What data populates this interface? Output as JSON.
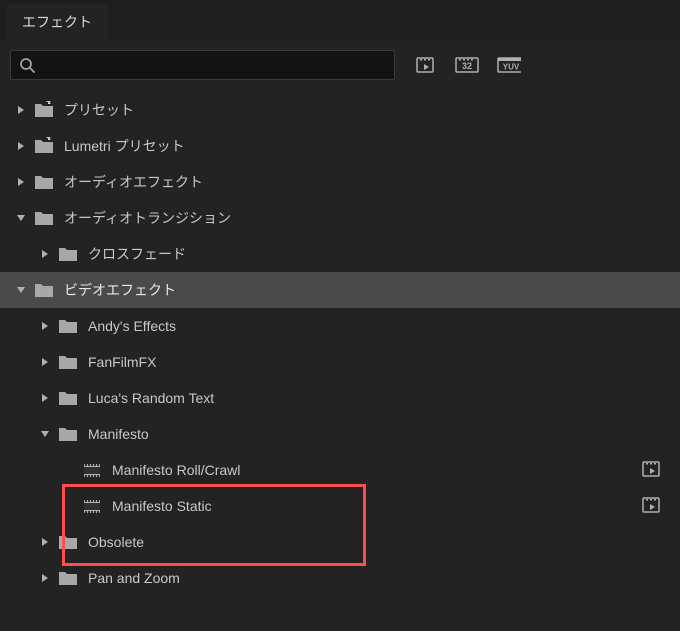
{
  "panel": {
    "title": "エフェクト"
  },
  "search": {
    "value": ""
  },
  "tree": {
    "presets": "プリセット",
    "lumetri": "Lumetri プリセット",
    "audioEffects": "オーディオエフェクト",
    "audioTransitions": "オーディオトランジション",
    "crossfade": "クロスフェード",
    "videoEffects": "ビデオエフェクト",
    "andys": "Andy's Effects",
    "fanfilm": "FanFilmFX",
    "lucas": "Luca's Random Text",
    "manifesto": "Manifesto",
    "manifestoRoll": "Manifesto Roll/Crawl",
    "manifestoStatic": "Manifesto Static",
    "obsolete": "Obsolete",
    "panzoom": "Pan and Zoom"
  }
}
